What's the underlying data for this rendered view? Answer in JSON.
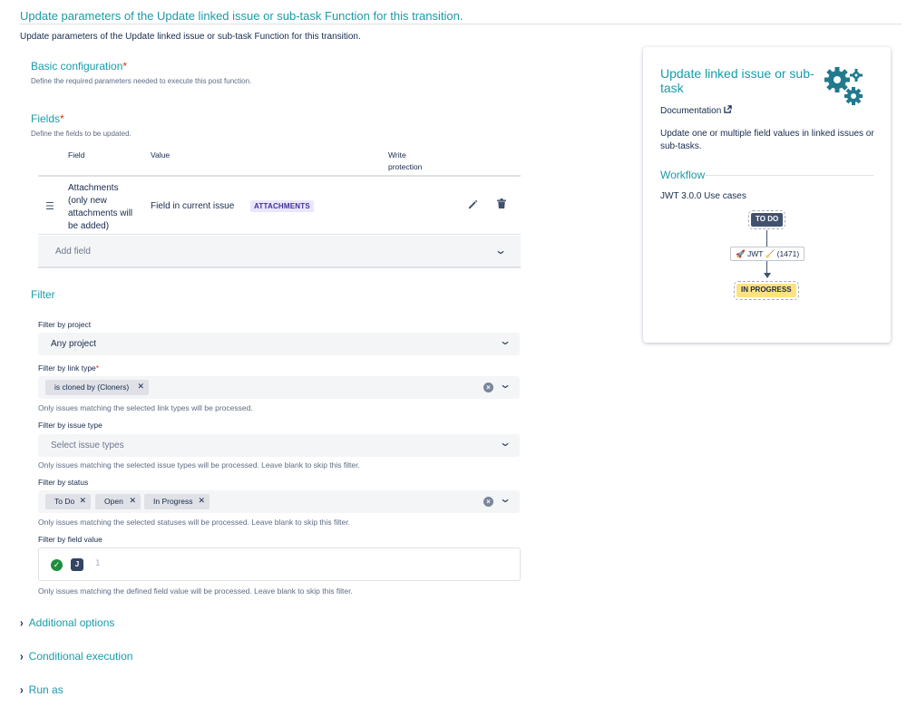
{
  "header": {
    "title": "Update parameters of the Update linked issue or sub-task Function for this transition.",
    "description": "Update parameters of the Update linked issue or sub-task Function for this transition."
  },
  "basic_config": {
    "title": "Basic configuration",
    "required_mark": "*",
    "description": "Define the required parameters needed to execute this post function."
  },
  "fields": {
    "title": "Fields",
    "required_mark": "*",
    "description": "Define the fields to be updated.",
    "columns": {
      "field": "Field",
      "value": "Value",
      "write_protection_1": "Write",
      "write_protection_2": "protection"
    },
    "rows": [
      {
        "name_lines": [
          "Attachments",
          "(only new",
          "attachments will",
          "be added)"
        ],
        "value": "Field in current issue",
        "badge": "ATTACHMENTS"
      }
    ],
    "add_placeholder": "Add field"
  },
  "filter": {
    "title": "Filter",
    "by_project": {
      "label": "Filter by project",
      "value": "Any project"
    },
    "by_link_type": {
      "label": "Filter by link type",
      "required_mark": "*",
      "chips": [
        "is cloned by (Cloners)"
      ],
      "hint": "Only issues matching the selected link types will be processed."
    },
    "by_issue_type": {
      "label": "Filter by issue type",
      "placeholder": "Select issue types",
      "hint": "Only issues matching the selected issue types will be processed. Leave blank to skip this filter."
    },
    "by_status": {
      "label": "Filter by status",
      "chips": [
        "To Do",
        "Open",
        "In Progress"
      ],
      "hint": "Only issues matching the selected statuses will be processed. Leave blank to skip this filter."
    },
    "by_field_value": {
      "label": "Filter by field value",
      "line_number": "1",
      "hint": "Only issues matching the defined field value will be processed. Leave blank to skip this filter."
    }
  },
  "collapsibles": {
    "additional_options": "Additional options",
    "conditional_execution": "Conditional execution",
    "run_as": "Run as"
  },
  "side_card": {
    "title": "Update linked issue or sub-task",
    "documentation": "Documentation",
    "description": "Update one or multiple field values in linked issues or sub-tasks.",
    "workflow_title": "Workflow",
    "workflow_subtitle": "JWT 3.0.0 Use cases",
    "status_from": "TO DO",
    "transition_label": "JWT",
    "transition_id": "(1471)",
    "status_to": "IN PROGRESS"
  },
  "colors": {
    "accent": "#1b9aaa",
    "required": "#de350b",
    "badge_bg": "#eae6ff",
    "badge_text": "#403294",
    "status_todo": "#42526e",
    "status_in_progress": "#ffe380",
    "check_green": "#1e8e3e"
  },
  "icons": {
    "drag": "drag-handle-icon",
    "edit": "pencil-icon",
    "delete": "trash-icon",
    "dropdown": "chevron-down-icon",
    "clear": "clear-icon",
    "remove": "close-icon",
    "external": "external-link-icon",
    "gears": "gears-icon",
    "check": "check-circle-icon",
    "jwt": "jwt-icon",
    "expand": "chevron-right-icon"
  }
}
